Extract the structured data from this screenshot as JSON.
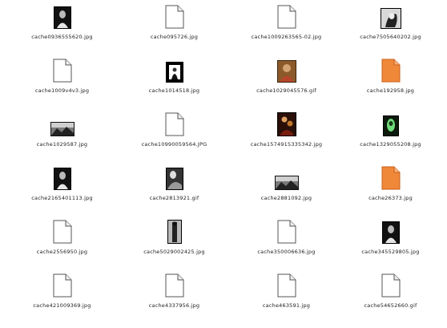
{
  "files": [
    {
      "name": "cache0936555620.jpg",
      "icon": "photo-portrait-dark"
    },
    {
      "name": "cache095726.jpg",
      "icon": "blank-document"
    },
    {
      "name": "cache1009263565-02.jpg",
      "icon": "blank-document"
    },
    {
      "name": "cache7505640202.jpg",
      "icon": "photo-portrait-light"
    },
    {
      "name": "cache1009v4v3.jpg",
      "icon": "blank-document"
    },
    {
      "name": "cache1014518.jpg",
      "icon": "photo-framed-dark"
    },
    {
      "name": "cache1029045576.gif",
      "icon": "photo-color-portrait"
    },
    {
      "name": "cache192958.jpg",
      "icon": "orange-document"
    },
    {
      "name": "cache1029587.jpg",
      "icon": "photo-landscape"
    },
    {
      "name": "cache10990059564.JPG",
      "icon": "blank-document"
    },
    {
      "name": "cache1574915335342.jpg",
      "icon": "photo-color-dark"
    },
    {
      "name": "cache1329055208.jpg",
      "icon": "photo-green-figure"
    },
    {
      "name": "cache2165401113.jpg",
      "icon": "photo-portrait-dark"
    },
    {
      "name": "cache2813921.gif",
      "icon": "photo-portrait-gray"
    },
    {
      "name": "cache2881092.jpg",
      "icon": "photo-landscape"
    },
    {
      "name": "cache26373.jpg",
      "icon": "orange-document"
    },
    {
      "name": "cache2556950.jpg",
      "icon": "blank-document"
    },
    {
      "name": "cache5029002425.jpg",
      "icon": "photo-figure-tall"
    },
    {
      "name": "cache350006636.jpg",
      "icon": "blank-document"
    },
    {
      "name": "cache345529805.jpg",
      "icon": "photo-portrait-dark"
    },
    {
      "name": "cache421009369.jpg",
      "icon": "blank-document"
    },
    {
      "name": "cache4337956.jpg",
      "icon": "blank-document"
    },
    {
      "name": "cache463591.jpg",
      "icon": "blank-document"
    },
    {
      "name": "cache54652660.gif",
      "icon": "blank-document"
    }
  ]
}
